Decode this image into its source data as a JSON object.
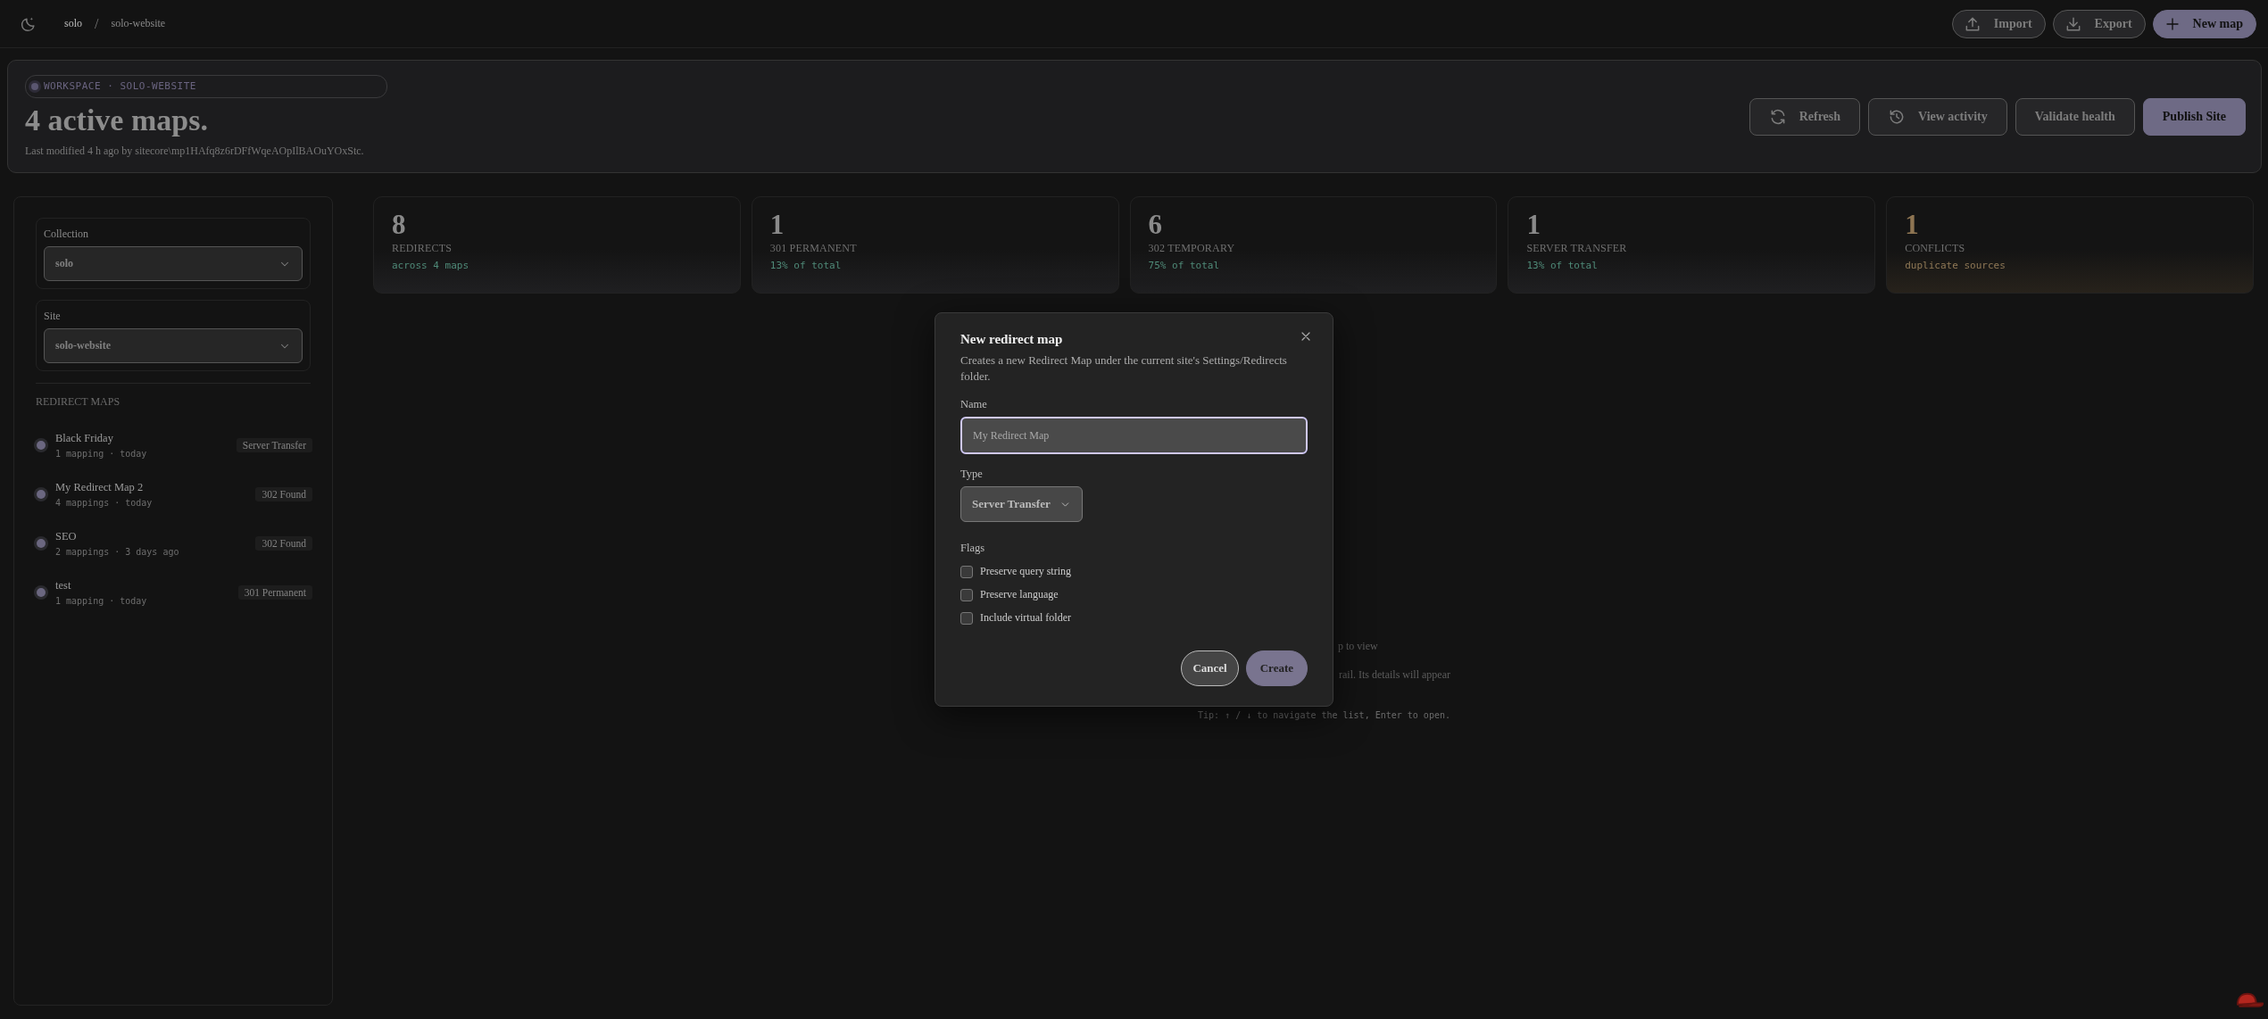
{
  "topbar": {
    "breadcrumb": [
      "solo",
      "solo-website"
    ],
    "separator": "/",
    "actions": [
      {
        "label": "Import",
        "kind": "import",
        "primary": false
      },
      {
        "label": "Export",
        "kind": "export",
        "primary": false
      },
      {
        "label": "New map",
        "kind": "add",
        "primary": true
      }
    ]
  },
  "header": {
    "eyebrow": "WORKSPACE · SOLO-WEBSITE",
    "title": "4 active maps.",
    "subtitle": "Last modified 4 h ago by sitecore\\mp1HAfq8z6rDFfWqeAOpIlBAOuYOxStc.",
    "actions": [
      {
        "label": "Refresh",
        "kind": "refresh",
        "primary": false
      },
      {
        "label": "View activity",
        "kind": "history",
        "primary": false
      },
      {
        "label": "Validate health",
        "kind": "none",
        "primary": false
      },
      {
        "label": "Publish Site",
        "kind": "none",
        "primary": true
      }
    ]
  },
  "stats": [
    {
      "value": "8",
      "label": "REDIRECTS",
      "note": "across 4 maps",
      "kind": "normal"
    },
    {
      "value": "1",
      "label": "301 PERMANENT",
      "note": "13% of total",
      "kind": "normal"
    },
    {
      "value": "6",
      "label": "302 TEMPORARY",
      "note": "75% of total",
      "kind": "normal"
    },
    {
      "value": "1",
      "label": "SERVER TRANSFER",
      "note": "13% of total",
      "kind": "normal"
    },
    {
      "value": "1",
      "label": "CONFLICTS",
      "note": "duplicate sources",
      "kind": "warning"
    }
  ],
  "sidebar": {
    "filters": [
      {
        "label": "Collection",
        "value": "solo"
      },
      {
        "label": "Site",
        "value": "solo-website"
      }
    ],
    "section_title": "REDIRECT MAPS",
    "maps": [
      {
        "name": "Black Friday",
        "meta": "1 mapping · today",
        "badge": "Server Transfer"
      },
      {
        "name": "My Redirect Map 2",
        "meta": "4 mappings · today",
        "badge": "302 Found"
      },
      {
        "name": "SEO",
        "meta": "2 mappings · 3 days ago",
        "badge": "302 Found"
      },
      {
        "name": "test",
        "meta": "1 mapping · today",
        "badge": "301 Permanent"
      }
    ]
  },
  "empty_state": {
    "line_1": "p to view",
    "line_2": "rail. Its details will appear",
    "tip": "Tip: ↑ / ↓ to navigate the list, Enter to open."
  },
  "dialog": {
    "title": "New redirect map",
    "description": "Creates a new Redirect Map under the current site's Settings/Redirects folder.",
    "name_field": {
      "label": "Name",
      "placeholder": "My Redirect Map"
    },
    "type_field": {
      "label": "Type",
      "value": "Server Transfer"
    },
    "flags_label": "Flags",
    "flags": [
      {
        "label": "Preserve query string",
        "checked": false
      },
      {
        "label": "Preserve language",
        "checked": false
      },
      {
        "label": "Include virtual folder",
        "checked": false
      }
    ],
    "buttons": [
      {
        "label": "Cancel",
        "kind": "secondary"
      },
      {
        "label": "Create",
        "kind": "primary"
      }
    ]
  }
}
